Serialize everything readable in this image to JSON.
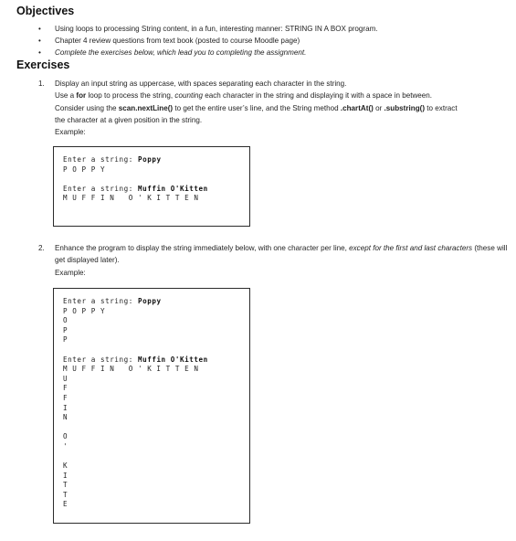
{
  "document": {
    "objectives": {
      "heading": "Objectives",
      "bullets": [
        "Using loops to processing String content, in a fun, interesting manner: STRING IN A BOX program.",
        "Chapter 4 review questions from text book (posted to course Moodle page)",
        "Complete the exercises below, which lead you to completing the assignment."
      ]
    },
    "exercises": {
      "heading": "Exercises",
      "item_1": {
        "number": "1.",
        "line_1": "Display an input string as uppercase, with spaces separating each character in the string.",
        "line_2_a": "Use a ",
        "line_2_bold": "for",
        "line_2_b": " loop to process the string, ",
        "line_2_italic": "counting",
        "line_2_c": " each character in the string and displaying it with a space in between.",
        "line_3_a": "Consider using the ",
        "line_3_bold_1": "scan.nextLine()",
        "line_3_b": " to get the entire user’s line, and the String method ",
        "line_3_bold_2": ".chartAt()",
        "line_3_c": " or ",
        "line_3_bold_3": ".substring()",
        "line_3_d": " to extract",
        "line_4": "the character at a given position in the string.",
        "example_label": "Example:"
      },
      "item_2": {
        "number": "2.",
        "line_1_a": "Enhance the program to display the string immediately below, with one character per line, ",
        "line_1_italic": "except for the first and last",
        "line_2_italic": "characters",
        "line_2_b": " (these will get displayed later).",
        "example_label": "Example:"
      }
    },
    "console_1": {
      "prompt_1": "Enter a string: ",
      "input_1": "Poppy",
      "output_1": "P O P P Y",
      "prompt_2": "Enter a string: ",
      "input_2": "Muffin O'Kitten",
      "output_2": "M U F F I N   O ' K I T T E N"
    },
    "console_2": {
      "prompt_1": "Enter a string: ",
      "input_1": "Poppy",
      "output_1": "P O P P Y",
      "vertical_1": "O\nP\nP",
      "prompt_2": "Enter a string: ",
      "input_2": "Muffin O'Kitten",
      "output_2": "M U F F I N   O ' K I T T E N",
      "vertical_2": "U\nF\nF\nI\nN\n\nO\n'\n\nK\nI\nT\nT\nE"
    }
  }
}
